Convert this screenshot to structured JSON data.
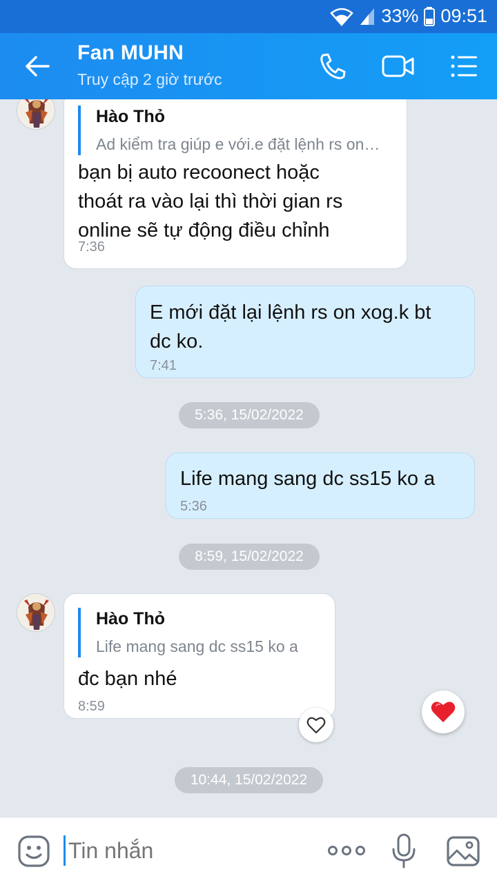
{
  "status_bar": {
    "battery": "33%",
    "time": "09:51",
    "icons": [
      "wifi-icon",
      "signal-icon",
      "battery-icon"
    ]
  },
  "header": {
    "title": "Fan MUHN",
    "subtitle": "Truy cập 2 giờ trước",
    "actions": [
      "phone-call-icon",
      "video-call-icon",
      "menu-icon"
    ],
    "background": "#1d8cf0"
  },
  "messages": [
    {
      "direction": "incoming",
      "quote": {
        "name": "Hào Thỏ",
        "text": "Ad kiểm tra giúp e với.e đặt lệnh rs online"
      },
      "lines": [
        "bạn bị auto recoonect hoặc",
        "thoát ra vào lại thì thời gian rs",
        "online sẽ tự động điều chỉnh"
      ],
      "time": "7:36"
    },
    {
      "direction": "outgoing",
      "lines": [
        "E mới đặt lại lệnh rs on xog.k bt",
        "dc ko."
      ],
      "time": "7:41"
    },
    {
      "direction": "outgoing",
      "lines": [
        "Life mang sang dc ss15 ko a"
      ],
      "time": "5:36"
    },
    {
      "direction": "incoming",
      "quote": {
        "name": "Hào Thỏ",
        "text": "Life mang sang dc ss15 ko a"
      },
      "lines": [
        "đc bạn nhé"
      ],
      "time": "8:59"
    }
  ],
  "date_separators": [
    "5:36, 15/02/2022",
    "8:59, 15/02/2022",
    "10:44, 15/02/2022"
  ],
  "composer": {
    "placeholder": "Tin nhắn",
    "icons": [
      "emoji-icon",
      "more-icon",
      "microphone-icon",
      "image-icon"
    ]
  },
  "colors": {
    "accent": "#1a8bf0",
    "outgoing_bubble": "#d6efff",
    "incoming_bubble": "#ffffff",
    "heart": "#e8202e",
    "chat_background": "#e3e8ee"
  }
}
